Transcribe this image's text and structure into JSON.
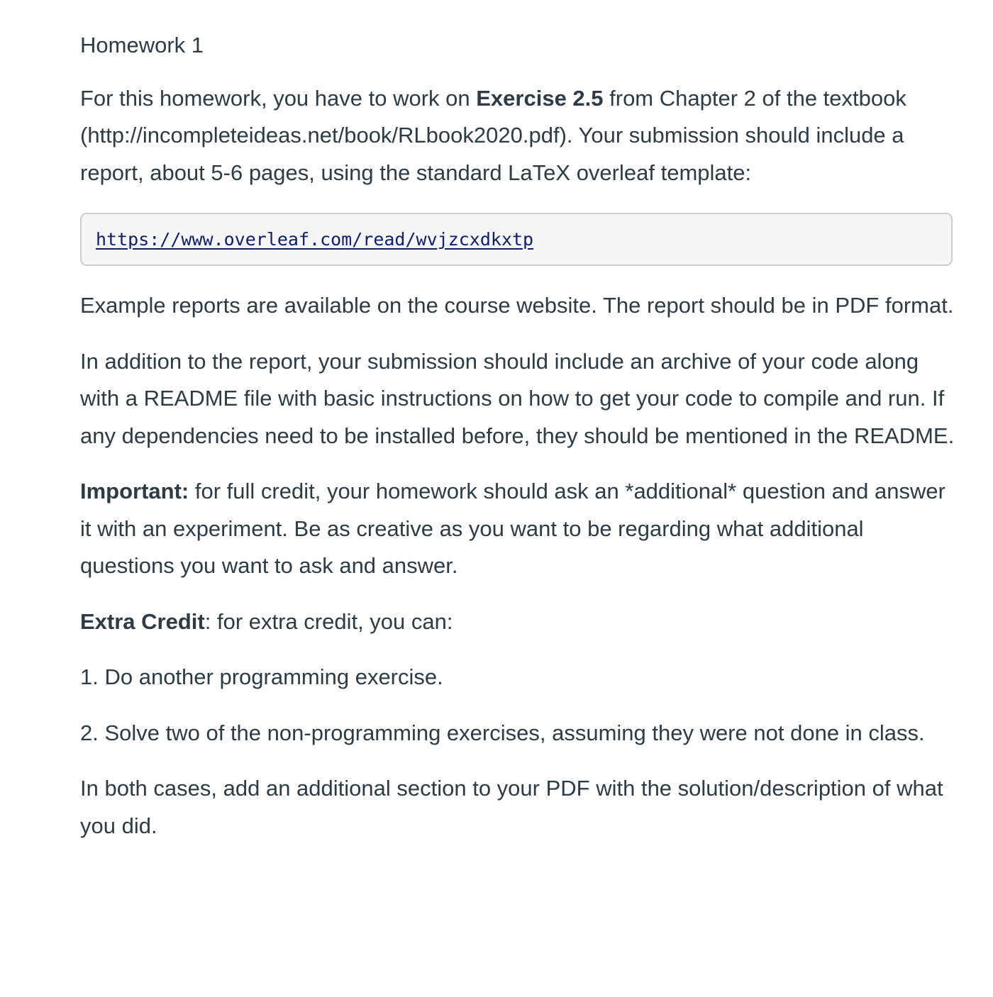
{
  "title": "Homework 1",
  "intro": {
    "before_bold": "For this homework, you have to work on ",
    "bold": "Exercise 2.5",
    "after_bold": " from Chapter 2 of the textbook (http://incompleteideas.net/book/RLbook2020.pdf). Your submission should include a report, about 5-6 pages, using the standard LaTeX overleaf template:"
  },
  "template_link": "https://www.overleaf.com/read/wvjzcxdkxtp",
  "examples_paragraph": "Example reports are available on the course website. The report should be in PDF format.",
  "code_paragraph": "In addition to the report, your submission should include an archive of your code along with a README file with basic instructions on how to get your code to compile and run. If any dependencies need to be installed before, they should be mentioned in the README.",
  "important": {
    "label": "Important:",
    "text": " for full credit, your homework should ask an *additional* question and answer it with an experiment. Be as creative as you want to be regarding what additional questions you want to ask and answer."
  },
  "extra_credit": {
    "label": "Extra Credit",
    "text": ": for extra credit, you can:"
  },
  "options": [
    "1. Do another programming exercise.",
    "2. Solve two of the non-programming exercises, assuming they were not done in class."
  ],
  "closing_paragraph": "In both cases, add an additional section to your PDF with the solution/description of what you did."
}
